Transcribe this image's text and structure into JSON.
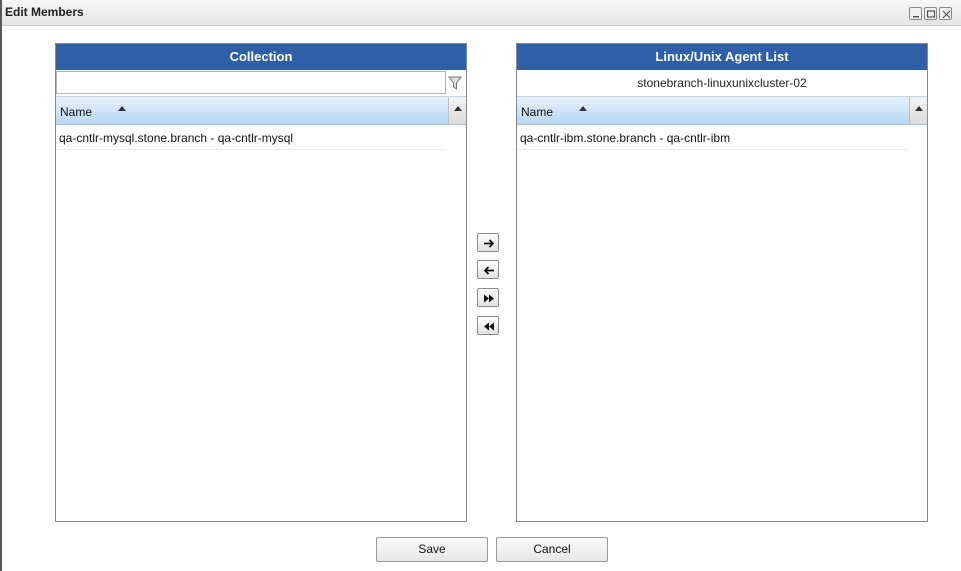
{
  "window": {
    "title": "Edit Members"
  },
  "left_panel": {
    "header": "Collection",
    "filter_value": "",
    "column_header": "Name",
    "rows": [
      "qa-cntlr-mysql.stone.branch - qa-cntlr-mysql"
    ]
  },
  "right_panel": {
    "header": "Linux/Unix Agent List",
    "subtitle": "stonebranch-linuxunixcluster-02",
    "column_header": "Name",
    "rows": [
      "qa-cntlr-ibm.stone.branch - qa-cntlr-ibm"
    ]
  },
  "transfer_buttons": [
    "move-right",
    "move-left",
    "move-all-right",
    "move-all-left"
  ],
  "buttons": {
    "save": "Save",
    "cancel": "Cancel"
  },
  "colors": {
    "panel_header": "#2f5fa7",
    "column_header": "#b9d7f4"
  }
}
